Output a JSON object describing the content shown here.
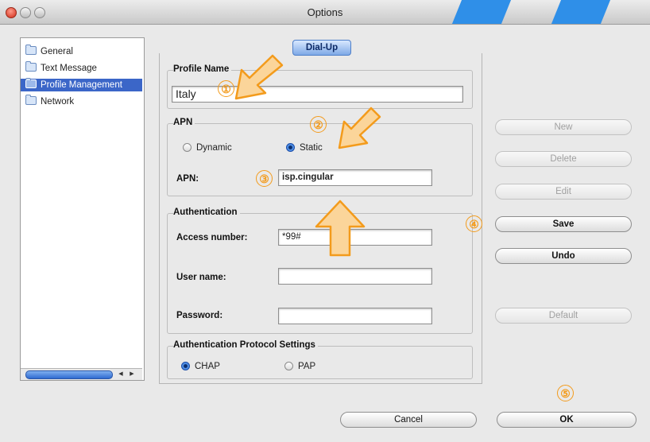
{
  "window": {
    "title": "Options"
  },
  "sidebar": {
    "items": [
      {
        "label": "General",
        "selected": false
      },
      {
        "label": "Text Message",
        "selected": false
      },
      {
        "label": "Profile Management",
        "selected": true
      },
      {
        "label": "Network",
        "selected": false
      }
    ]
  },
  "tabs": [
    {
      "label": "Dial-Up",
      "active": true
    }
  ],
  "profile": {
    "group_label": "Profile Name",
    "value": "Italy"
  },
  "apn": {
    "group_label": "APN",
    "options": [
      {
        "label": "Dynamic",
        "selected": false
      },
      {
        "label": "Static",
        "selected": true
      }
    ],
    "field_label": "APN:",
    "field_value": "isp.cingular"
  },
  "authentication": {
    "group_label": "Authentication",
    "access_number_label": "Access number:",
    "access_number_value": "*99#",
    "user_name_label": "User name:",
    "user_name_value": "",
    "password_label": "Password:",
    "password_value": ""
  },
  "protocol": {
    "group_label": "Authentication Protocol Settings",
    "options": [
      {
        "label": "CHAP",
        "selected": true
      },
      {
        "label": "PAP",
        "selected": false
      }
    ]
  },
  "side_buttons": {
    "new": {
      "label": "New",
      "enabled": false
    },
    "delete": {
      "label": "Delete",
      "enabled": false
    },
    "edit": {
      "label": "Edit",
      "enabled": false
    },
    "save": {
      "label": "Save",
      "enabled": true
    },
    "undo": {
      "label": "Undo",
      "enabled": true
    },
    "default": {
      "label": "Default",
      "enabled": false
    }
  },
  "footer": {
    "cancel_label": "Cancel",
    "ok_label": "OK"
  },
  "annotations": {
    "markers": [
      "①",
      "②",
      "③",
      "④",
      "⑤"
    ],
    "accent_color": "#f39b1c"
  },
  "colors": {
    "selection": "#3b66c8",
    "title_stripe": "#2f8fe8"
  }
}
